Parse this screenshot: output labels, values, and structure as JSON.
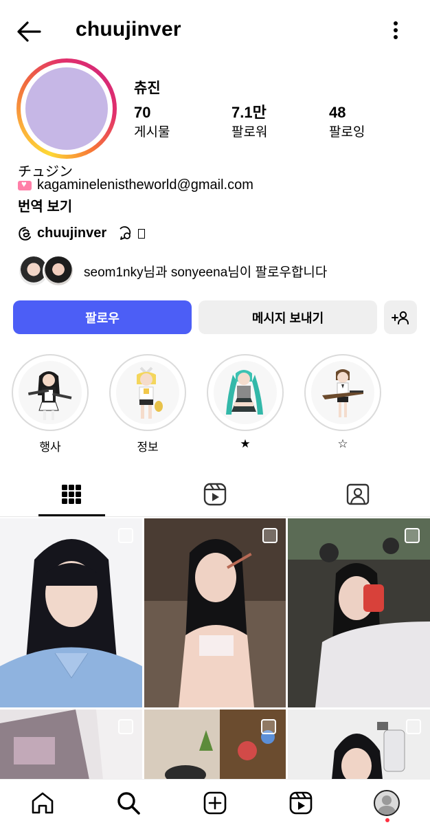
{
  "header": {
    "username": "chuujinver",
    "back_icon": "arrow-left-icon",
    "more_icon": "kebab-menu-icon"
  },
  "profile": {
    "display_name": "츄진",
    "avatar_color": "#c6b7e6",
    "stats": [
      {
        "value": "70",
        "label": "게시물"
      },
      {
        "value": "7.1만",
        "label": "팔로워"
      },
      {
        "value": "48",
        "label": "팔로잉"
      }
    ],
    "bio_name": "チュジン",
    "bio_email": "kagaminelenistheworld@gmail.com",
    "translate_label": "번역 보기",
    "threads_handle": "chuujinver"
  },
  "mutual": {
    "user1": "seom1nky",
    "connector": "님과 ",
    "user2": "sonyeena",
    "suffix": "님이 팔로우합니다"
  },
  "actions": {
    "follow_label": "팔로우",
    "message_label": "메시지 보내기",
    "follow_color": "#4c5ef6",
    "add_icon": "add-person-icon"
  },
  "highlights": [
    {
      "label": "행사"
    },
    {
      "label": "정보"
    },
    {
      "label": "★"
    },
    {
      "label": "☆"
    }
  ],
  "tabs": [
    {
      "icon": "grid-icon"
    },
    {
      "icon": "reels-icon"
    },
    {
      "icon": "tagged-icon"
    }
  ],
  "bottom_nav": [
    {
      "icon": "home-icon"
    },
    {
      "icon": "search-icon"
    },
    {
      "icon": "create-icon"
    },
    {
      "icon": "reels-icon"
    },
    {
      "icon": "profile-icon"
    }
  ]
}
